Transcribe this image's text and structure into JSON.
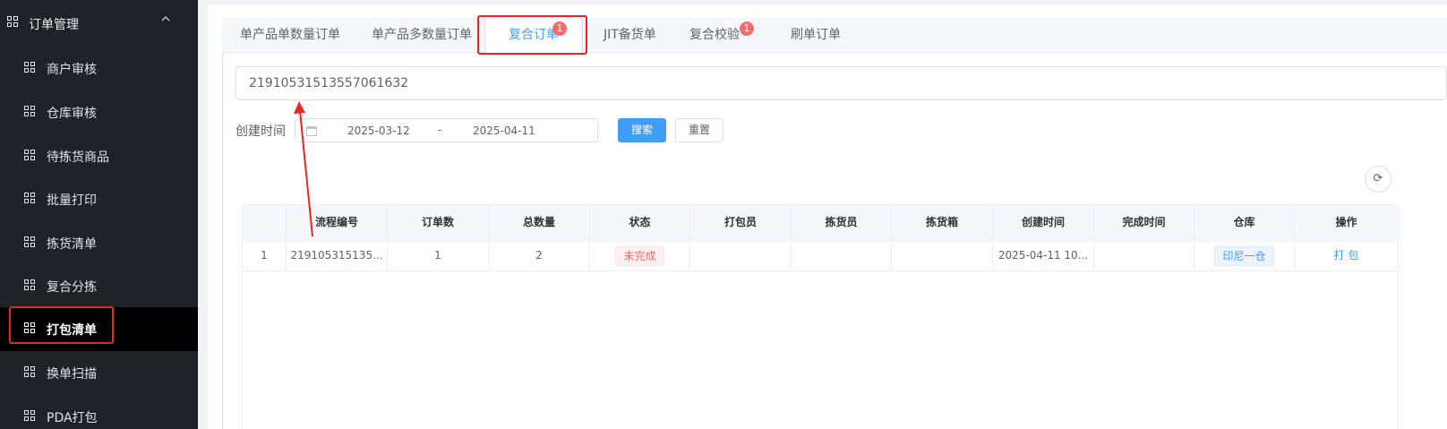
{
  "sidebar": {
    "group": {
      "label": "订单管理",
      "icon": "grid-icon",
      "toggle_icon": "chevron-up-icon"
    },
    "items": [
      {
        "label": "商户审核"
      },
      {
        "label": "仓库审核"
      },
      {
        "label": "待拣货商品"
      },
      {
        "label": "批量打印"
      },
      {
        "label": "拣货清单"
      },
      {
        "label": "复合分拣"
      },
      {
        "label": "打包清单",
        "active": true
      },
      {
        "label": "换单扫描"
      },
      {
        "label": "PDA打包"
      }
    ]
  },
  "tabs": [
    {
      "label": "单产品单数量订单"
    },
    {
      "label": "单产品多数量订单"
    },
    {
      "label": "复合订单",
      "badge": "1",
      "active": true
    },
    {
      "label": "JIT备货单"
    },
    {
      "label": "复合校验",
      "badge": "1"
    },
    {
      "label": "刷单订单"
    }
  ],
  "search": {
    "value": "21910531513557061632"
  },
  "filters": {
    "created_label": "创建时间",
    "date_start": "2025-03-12",
    "date_sep": "-",
    "date_end": "2025-04-11",
    "search_button": "搜索",
    "reset_button": "重置"
  },
  "table": {
    "columns": [
      "",
      "流程编号",
      "订单数",
      "总数量",
      "状态",
      "打包员",
      "拣货员",
      "拣货箱",
      "创建时间",
      "完成时间",
      "仓库",
      "操作"
    ],
    "rows": [
      {
        "index": "1",
        "flow_no": "219105315135...",
        "orders": "1",
        "qty": "2",
        "status": "未完成",
        "packer": "",
        "picker": "",
        "box": "",
        "created": "2025-04-11 10...",
        "finished": "",
        "warehouse": "印尼一仓",
        "action": "打 包"
      }
    ]
  },
  "colors": {
    "primary": "#409eff",
    "danger": "#f56c6c",
    "sidebar_bg": "#1f2227",
    "annotation": "#e8281e"
  }
}
